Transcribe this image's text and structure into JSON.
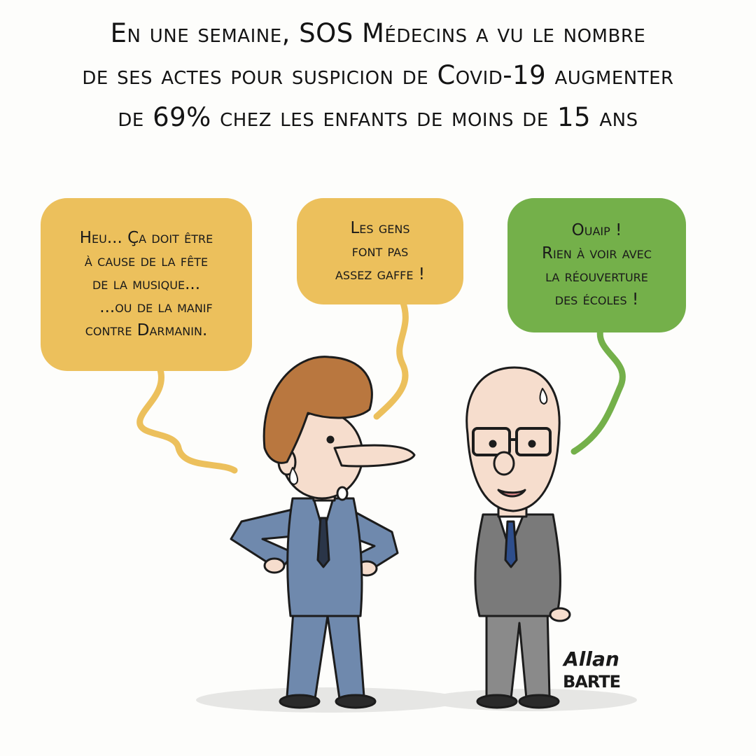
{
  "headline": {
    "lines": [
      "En une semaine, SOS Médecins a vu le nombre",
      "de ses actes pour suspicion de Covid-19 augmenter",
      "de 69% chez les enfants de moins de 15 ans"
    ]
  },
  "bubbles": {
    "left": {
      "lines": [
        "Heu... Ça doit être",
        "à cause de la fête",
        "de la musique...",
        "...ou de la manif",
        "contre Darmanin."
      ],
      "color": "#ecc05c"
    },
    "middle": {
      "lines": [
        "Les gens",
        "font pas",
        "assez gaffe !"
      ],
      "color": "#ecc05c"
    },
    "right": {
      "lines": [
        "Ouaip !",
        "Rien à voir avec",
        "la réouverture",
        "des écoles !"
      ],
      "color": "#74b04a"
    }
  },
  "signature": {
    "line1": "Allan",
    "line2": "BARTE"
  },
  "colors": {
    "suit_blue": "#6f89ad",
    "suit_grey": "#7a7a7a",
    "hair": "#b9773f",
    "skin": "#f6ddcd"
  }
}
